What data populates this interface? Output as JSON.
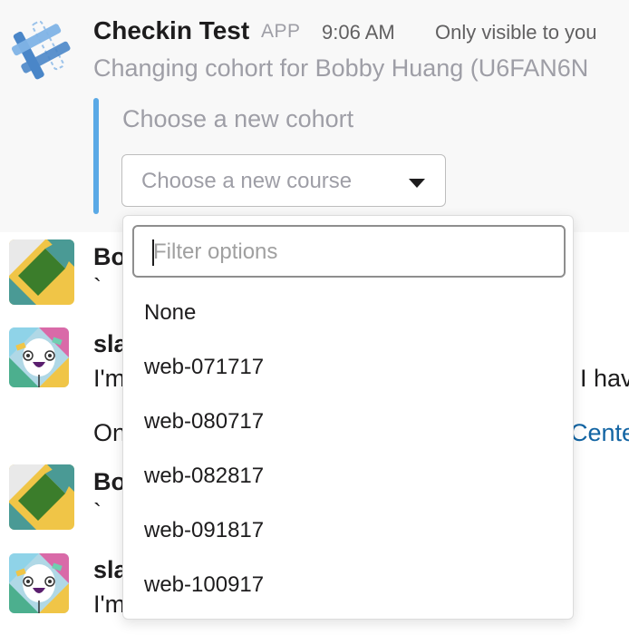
{
  "app_message": {
    "app_name": "Checkin Test",
    "badge": "APP",
    "time": "9:06 AM",
    "visibility": "Only visible to you",
    "text": "Changing cohort for Bobby Huang (U6FAN6N",
    "attachment_title": "Choose a new cohort",
    "select_placeholder": "Choose a new course",
    "avatar_icon": "hashtag-app-icon"
  },
  "messages": [
    {
      "name": "Bo",
      "text": "`"
    },
    {
      "name": "sla",
      "text": "I'm",
      "text_right": "I hav"
    },
    {
      "text": "On",
      "link": "Cente"
    },
    {
      "name": "Bo",
      "text": "`"
    },
    {
      "name": "sla",
      "text": "I'm"
    }
  ],
  "dropdown": {
    "filter_placeholder": "Filter options",
    "options": [
      "None",
      "web-071717",
      "web-080717",
      "web-082817",
      "web-091817",
      "web-100917"
    ]
  },
  "colors": {
    "accent_bar": "#5aa9e6",
    "link": "#1264a3",
    "app_bg": "#f8f8f8"
  }
}
